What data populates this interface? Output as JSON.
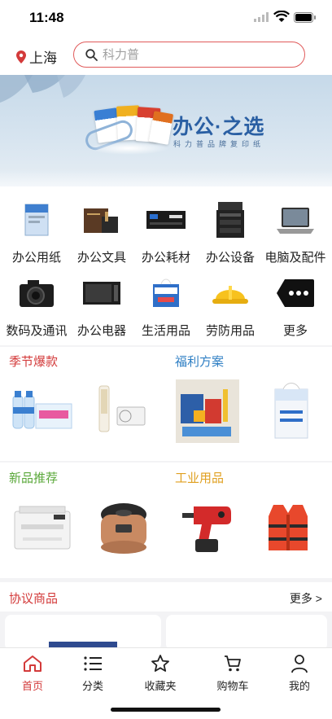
{
  "status_bar": {
    "time": "11:48"
  },
  "header": {
    "location": "上海",
    "search_placeholder": "科力普"
  },
  "banner": {
    "title": "办公·之选",
    "subtitle": "科力普品牌复印纸"
  },
  "categories": [
    {
      "label": "办公用纸",
      "icon": "paper-ream-icon"
    },
    {
      "label": "办公文具",
      "icon": "stationery-box-icon"
    },
    {
      "label": "办公耗材",
      "icon": "toner-cartridge-icon"
    },
    {
      "label": "办公设备",
      "icon": "copier-icon"
    },
    {
      "label": "电脑及配件",
      "icon": "laptop-icon"
    },
    {
      "label": "数码及通讯",
      "icon": "camera-icon"
    },
    {
      "label": "办公电器",
      "icon": "microwave-icon"
    },
    {
      "label": "生活用品",
      "icon": "tissue-box-icon"
    },
    {
      "label": "劳防用品",
      "icon": "hard-hat-icon"
    },
    {
      "label": "更多",
      "icon": "more-tag-icon"
    }
  ],
  "sections": {
    "seasonal": {
      "title": "季节爆款",
      "color": "#d33a3a"
    },
    "welfare": {
      "title": "福利方案",
      "color": "#2f7fc4"
    },
    "new": {
      "title": "新品推荐",
      "color": "#5aa83a"
    },
    "industrial": {
      "title": "工业用品",
      "color": "#e0a020"
    }
  },
  "agreement": {
    "title": "协议商品",
    "more": "更多 >"
  },
  "tabbar": [
    {
      "label": "首页",
      "icon": "home-icon",
      "active": true
    },
    {
      "label": "分类",
      "icon": "list-icon",
      "active": false
    },
    {
      "label": "收藏夹",
      "icon": "star-icon",
      "active": false
    },
    {
      "label": "购物车",
      "icon": "cart-icon",
      "active": false
    },
    {
      "label": "我的",
      "icon": "user-icon",
      "active": false
    }
  ]
}
